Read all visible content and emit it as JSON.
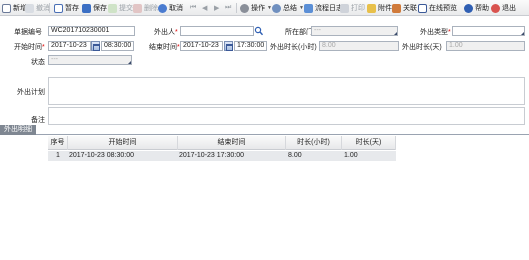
{
  "toolbar": {
    "new": "新增",
    "withdraw": "撤消",
    "draft": "暂存",
    "save": "保存",
    "submit": "提交",
    "delete": "删除",
    "cancel": "取消",
    "operate": "操作",
    "summary": "总结",
    "flow_log": "流程日志",
    "print": "打印",
    "attachment": "附件",
    "related": "关联",
    "online_preview": "在线预览",
    "help": "帮助",
    "exit": "退出"
  },
  "form": {
    "doc_no_label": "单据编号",
    "doc_no_value": "WC201710230001",
    "person_label": "外出人",
    "person_value": "",
    "dept_label": "所在部门",
    "dept_value": "---",
    "type_label": "外出类型",
    "type_value": "",
    "start_label": "开始时间",
    "start_date": "2017-10-23",
    "start_time": "08:30:00",
    "end_label": "结束时间",
    "end_date": "2017-10-23",
    "end_time": "17:30:00",
    "hours_label": "外出时长(小时)",
    "hours_value": "8.00",
    "days_label": "外出时长(天)",
    "days_value": "1.00",
    "status_label": "状态",
    "status_value": "---",
    "plan_label": "外出计划",
    "remark_label": "备注"
  },
  "detail_tab": "外出明细",
  "grid": {
    "headers": [
      "序号",
      "开始时间",
      "结束时间",
      "时长(小时)",
      "时长(天)"
    ],
    "rows": [
      [
        "1",
        "2017-10-23 08:30:00",
        "2017-10-23 17:30:00",
        "8.00",
        "1.00"
      ]
    ]
  },
  "colors": {
    "toolbar_bg": "#e9eaec",
    "required": "#dd0000",
    "tab_bg": "#7f8792",
    "row_bg": "#e7e9ec"
  }
}
